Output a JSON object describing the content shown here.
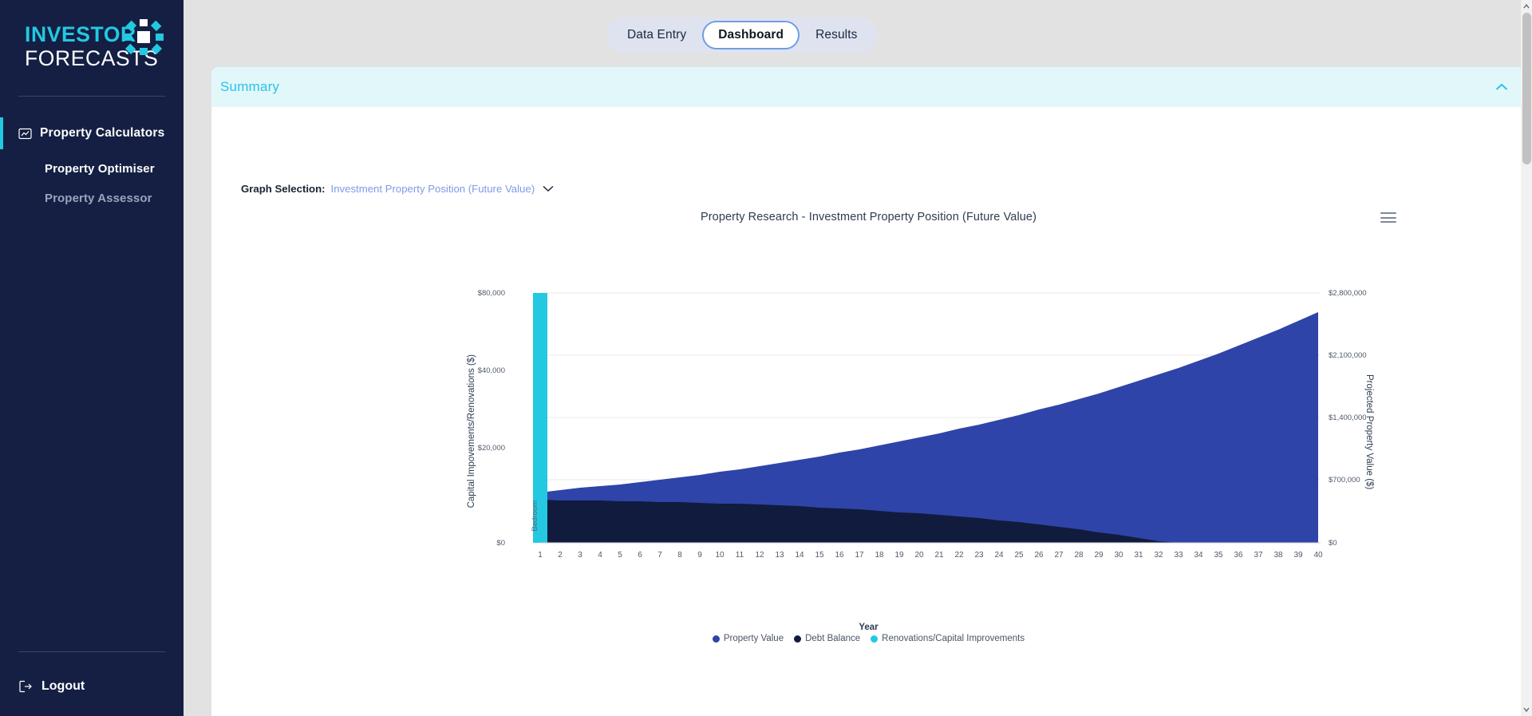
{
  "sidebar": {
    "logo": {
      "line1": "INVESTOR",
      "line2": "FORECASTS",
      "mark_icon": "asterisk-burst-icon"
    },
    "nav": [
      {
        "label": "Property Calculators",
        "icon": "chart-box-icon",
        "active": true
      },
      {
        "label": "Property Optimiser",
        "active": false
      },
      {
        "label": "Property Assessor",
        "active": false
      }
    ],
    "logout": {
      "label": "Logout",
      "icon": "logout-icon"
    }
  },
  "tabs": [
    {
      "label": "Data Entry",
      "active": false
    },
    {
      "label": "Dashboard",
      "active": true
    },
    {
      "label": "Results",
      "active": false
    }
  ],
  "card": {
    "title": "Summary",
    "collapse_icon": "chevron-up-icon",
    "graph_selection": {
      "label": "Graph Selection:",
      "value": "Investment Property Position (Future Value)",
      "chevron_icon": "chevron-down-icon"
    },
    "menu_icon": "hamburger-menu-icon"
  },
  "colors": {
    "sidebar_bg": "#141f43",
    "accent_cyan": "#22c9e0",
    "page_bg": "#e2e2e2",
    "card_header_bg": "#e2f7fa",
    "summary_text": "#29c3e8",
    "tab_group_bg": "#dfe3f0",
    "tab_active_border": "#6f9fe0",
    "property_value": "#2f44a8",
    "debt_balance": "#111b3d",
    "renovations": "#22c9e0"
  },
  "chart_data": {
    "type": "area",
    "title": "Property Research - Investment Property Position (Future Value)",
    "xlabel": "Year",
    "ylabel": "Capital Impovements/Renovations ($)",
    "y2label": "Projected Property Value ($)",
    "grid": true,
    "legend_position": "bottom",
    "x": [
      1,
      2,
      3,
      4,
      5,
      6,
      7,
      8,
      9,
      10,
      11,
      12,
      13,
      14,
      15,
      16,
      17,
      18,
      19,
      20,
      21,
      22,
      23,
      24,
      25,
      26,
      27,
      28,
      29,
      30,
      31,
      32,
      33,
      34,
      35,
      36,
      37,
      38,
      39,
      40
    ],
    "categories": [
      "1",
      "2",
      "3",
      "4",
      "5",
      "6",
      "7",
      "8",
      "9",
      "10",
      "11",
      "12",
      "13",
      "14",
      "15",
      "16",
      "17",
      "18",
      "19",
      "20",
      "21",
      "22",
      "23",
      "24",
      "25",
      "26",
      "27",
      "28",
      "29",
      "30",
      "31",
      "32",
      "33",
      "34",
      "35",
      "36",
      "37",
      "38",
      "39",
      "40"
    ],
    "y_left_ticks": [
      "$0",
      "$20,000",
      "$40,000",
      "$80,000"
    ],
    "y_left_tick_values": [
      0,
      20000,
      40000,
      80000
    ],
    "ylim": [
      0,
      80000
    ],
    "y_right_ticks": [
      "$0",
      "$700,000",
      "$1,400,000",
      "$2,100,000",
      "$2,800,000"
    ],
    "y_right_tick_values": [
      0,
      700000,
      1400000,
      2100000,
      2800000
    ],
    "y2lim": [
      0,
      2800000
    ],
    "annotations": [
      {
        "text": "Bedroom",
        "x": 1,
        "orientation": "vertical",
        "note": "category label under year 1 bar"
      }
    ],
    "series": [
      {
        "name": "Property Value",
        "type": "area",
        "color": "#2f44a8",
        "axis": "right",
        "values": [
          560000,
          582000,
          605000,
          629000,
          654000,
          680000,
          708000,
          736000,
          765000,
          796000,
          828000,
          861000,
          896000,
          931000,
          969000,
          1008000,
          1048000,
          1090000,
          1133000,
          1179000,
          1226000,
          1275000,
          1326000,
          1379000,
          1434000,
          1492000,
          1551000,
          1613000,
          1678000,
          1745000,
          1815000,
          1888000,
          1963000,
          2042000,
          2124000,
          2209000,
          2297000,
          2389000,
          2484000,
          2584000
        ]
      },
      {
        "name": "Debt Balance",
        "type": "area",
        "color": "#111b3d",
        "axis": "right",
        "values": [
          480000,
          478000,
          476000,
          473000,
          470000,
          466000,
          461000,
          456000,
          450000,
          443000,
          436000,
          428000,
          419000,
          409000,
          398000,
          386000,
          373000,
          359000,
          344000,
          328000,
          311000,
          293000,
          273000,
          252000,
          229000,
          205000,
          179000,
          151000,
          121000,
          89000,
          55000,
          18000,
          0,
          0,
          0,
          0,
          0,
          0,
          0,
          0
        ]
      },
      {
        "name": "Renovations/Capital Improvements",
        "type": "column",
        "color": "#22c9e0",
        "axis": "left",
        "values": [
          80000,
          0,
          0,
          0,
          0,
          0,
          0,
          0,
          0,
          0,
          0,
          0,
          0,
          0,
          0,
          0,
          0,
          0,
          0,
          0,
          0,
          0,
          0,
          0,
          0,
          0,
          0,
          0,
          0,
          0,
          0,
          0,
          0,
          0,
          0,
          0,
          0,
          0,
          0,
          0
        ]
      }
    ]
  }
}
